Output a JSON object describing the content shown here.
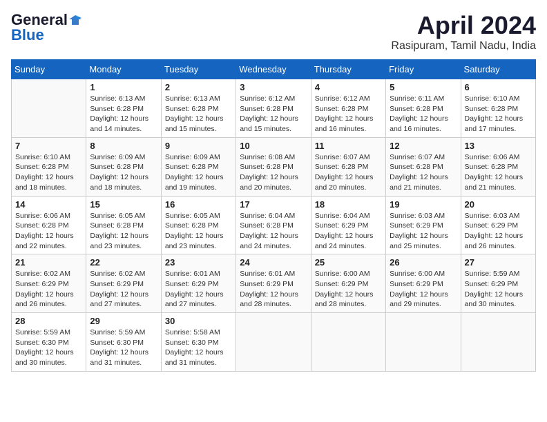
{
  "logo": {
    "line1": "General",
    "line2": "Blue"
  },
  "title": "April 2024",
  "location": "Rasipuram, Tamil Nadu, India",
  "weekdays": [
    "Sunday",
    "Monday",
    "Tuesday",
    "Wednesday",
    "Thursday",
    "Friday",
    "Saturday"
  ],
  "weeks": [
    [
      {
        "day": "",
        "info": ""
      },
      {
        "day": "1",
        "info": "Sunrise: 6:13 AM\nSunset: 6:28 PM\nDaylight: 12 hours\nand 14 minutes."
      },
      {
        "day": "2",
        "info": "Sunrise: 6:13 AM\nSunset: 6:28 PM\nDaylight: 12 hours\nand 15 minutes."
      },
      {
        "day": "3",
        "info": "Sunrise: 6:12 AM\nSunset: 6:28 PM\nDaylight: 12 hours\nand 15 minutes."
      },
      {
        "day": "4",
        "info": "Sunrise: 6:12 AM\nSunset: 6:28 PM\nDaylight: 12 hours\nand 16 minutes."
      },
      {
        "day": "5",
        "info": "Sunrise: 6:11 AM\nSunset: 6:28 PM\nDaylight: 12 hours\nand 16 minutes."
      },
      {
        "day": "6",
        "info": "Sunrise: 6:10 AM\nSunset: 6:28 PM\nDaylight: 12 hours\nand 17 minutes."
      }
    ],
    [
      {
        "day": "7",
        "info": "Sunrise: 6:10 AM\nSunset: 6:28 PM\nDaylight: 12 hours\nand 18 minutes."
      },
      {
        "day": "8",
        "info": "Sunrise: 6:09 AM\nSunset: 6:28 PM\nDaylight: 12 hours\nand 18 minutes."
      },
      {
        "day": "9",
        "info": "Sunrise: 6:09 AM\nSunset: 6:28 PM\nDaylight: 12 hours\nand 19 minutes."
      },
      {
        "day": "10",
        "info": "Sunrise: 6:08 AM\nSunset: 6:28 PM\nDaylight: 12 hours\nand 20 minutes."
      },
      {
        "day": "11",
        "info": "Sunrise: 6:07 AM\nSunset: 6:28 PM\nDaylight: 12 hours\nand 20 minutes."
      },
      {
        "day": "12",
        "info": "Sunrise: 6:07 AM\nSunset: 6:28 PM\nDaylight: 12 hours\nand 21 minutes."
      },
      {
        "day": "13",
        "info": "Sunrise: 6:06 AM\nSunset: 6:28 PM\nDaylight: 12 hours\nand 21 minutes."
      }
    ],
    [
      {
        "day": "14",
        "info": "Sunrise: 6:06 AM\nSunset: 6:28 PM\nDaylight: 12 hours\nand 22 minutes."
      },
      {
        "day": "15",
        "info": "Sunrise: 6:05 AM\nSunset: 6:28 PM\nDaylight: 12 hours\nand 23 minutes."
      },
      {
        "day": "16",
        "info": "Sunrise: 6:05 AM\nSunset: 6:28 PM\nDaylight: 12 hours\nand 23 minutes."
      },
      {
        "day": "17",
        "info": "Sunrise: 6:04 AM\nSunset: 6:28 PM\nDaylight: 12 hours\nand 24 minutes."
      },
      {
        "day": "18",
        "info": "Sunrise: 6:04 AM\nSunset: 6:29 PM\nDaylight: 12 hours\nand 24 minutes."
      },
      {
        "day": "19",
        "info": "Sunrise: 6:03 AM\nSunset: 6:29 PM\nDaylight: 12 hours\nand 25 minutes."
      },
      {
        "day": "20",
        "info": "Sunrise: 6:03 AM\nSunset: 6:29 PM\nDaylight: 12 hours\nand 26 minutes."
      }
    ],
    [
      {
        "day": "21",
        "info": "Sunrise: 6:02 AM\nSunset: 6:29 PM\nDaylight: 12 hours\nand 26 minutes."
      },
      {
        "day": "22",
        "info": "Sunrise: 6:02 AM\nSunset: 6:29 PM\nDaylight: 12 hours\nand 27 minutes."
      },
      {
        "day": "23",
        "info": "Sunrise: 6:01 AM\nSunset: 6:29 PM\nDaylight: 12 hours\nand 27 minutes."
      },
      {
        "day": "24",
        "info": "Sunrise: 6:01 AM\nSunset: 6:29 PM\nDaylight: 12 hours\nand 28 minutes."
      },
      {
        "day": "25",
        "info": "Sunrise: 6:00 AM\nSunset: 6:29 PM\nDaylight: 12 hours\nand 28 minutes."
      },
      {
        "day": "26",
        "info": "Sunrise: 6:00 AM\nSunset: 6:29 PM\nDaylight: 12 hours\nand 29 minutes."
      },
      {
        "day": "27",
        "info": "Sunrise: 5:59 AM\nSunset: 6:29 PM\nDaylight: 12 hours\nand 30 minutes."
      }
    ],
    [
      {
        "day": "28",
        "info": "Sunrise: 5:59 AM\nSunset: 6:30 PM\nDaylight: 12 hours\nand 30 minutes."
      },
      {
        "day": "29",
        "info": "Sunrise: 5:59 AM\nSunset: 6:30 PM\nDaylight: 12 hours\nand 31 minutes."
      },
      {
        "day": "30",
        "info": "Sunrise: 5:58 AM\nSunset: 6:30 PM\nDaylight: 12 hours\nand 31 minutes."
      },
      {
        "day": "",
        "info": ""
      },
      {
        "day": "",
        "info": ""
      },
      {
        "day": "",
        "info": ""
      },
      {
        "day": "",
        "info": ""
      }
    ]
  ]
}
